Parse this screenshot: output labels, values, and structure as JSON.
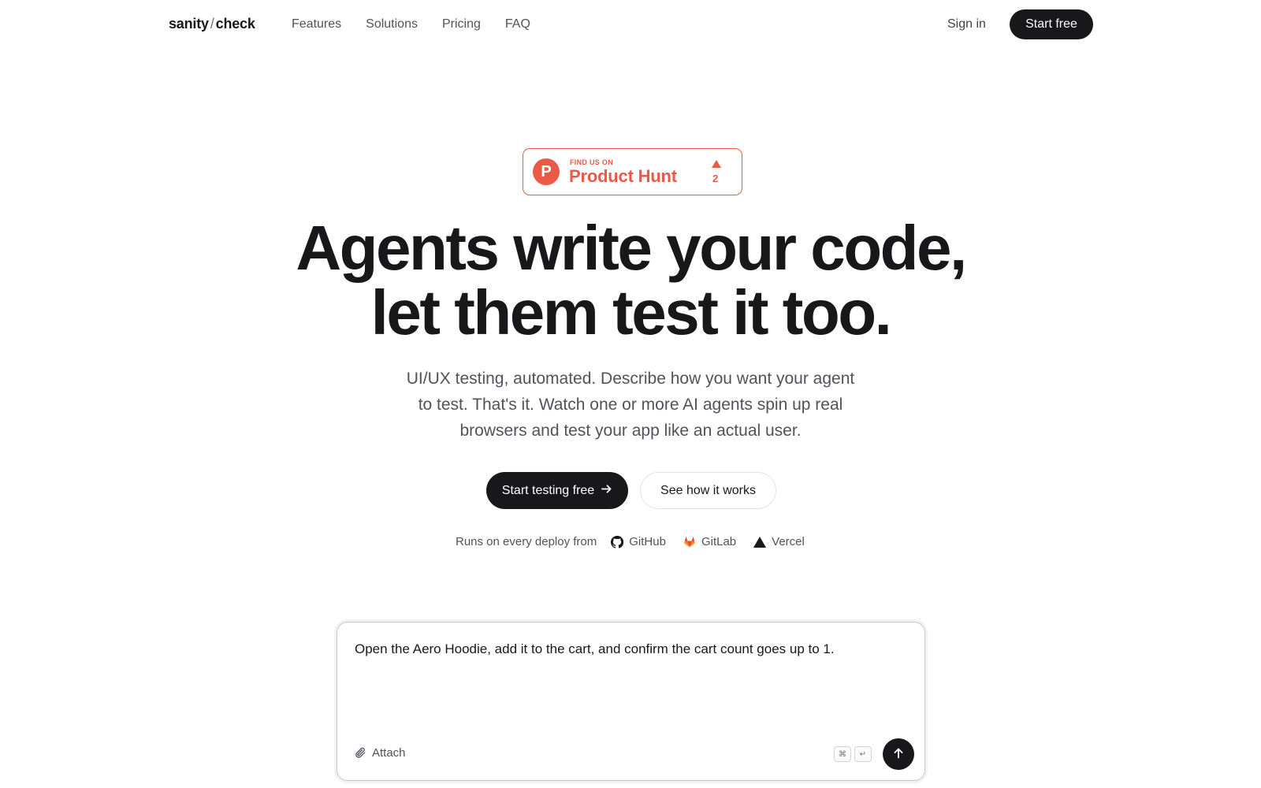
{
  "nav": {
    "logo_left": "sanity",
    "logo_sep": "/",
    "logo_right": "check",
    "links": [
      "Features",
      "Solutions",
      "Pricing",
      "FAQ"
    ],
    "sign_in": "Sign in",
    "start_free": "Start free"
  },
  "product_hunt": {
    "find_us": "FIND US ON",
    "name": "Product Hunt",
    "logo_letter": "P",
    "count": "2",
    "color": "#ea5a47"
  },
  "hero": {
    "headline_line1": "Agents write your code,",
    "headline_line2": "let them test it too.",
    "subtext": "UI/UX testing, automated. Describe how you want your agent to test. That's it. Watch one or more AI agents spin up real browsers and test your app like an actual user.",
    "cta_primary": "Start testing free",
    "cta_secondary": "See how it works"
  },
  "integrations": {
    "lead": "Runs on every deploy from",
    "items": [
      {
        "label": "GitHub",
        "icon": "github-icon"
      },
      {
        "label": "GitLab",
        "icon": "gitlab-icon"
      },
      {
        "label": "Vercel",
        "icon": "vercel-icon"
      }
    ]
  },
  "prompt": {
    "value": "Open the Aero Hoodie, add it to the cart, and confirm the cart count goes up to 1.",
    "attach": "Attach",
    "kbd_cmd": "⌘",
    "kbd_enter": "↵"
  },
  "colors": {
    "primary_dark": "#18181b",
    "muted_text": "#52525b",
    "accent_product_hunt": "#ea5a47"
  }
}
